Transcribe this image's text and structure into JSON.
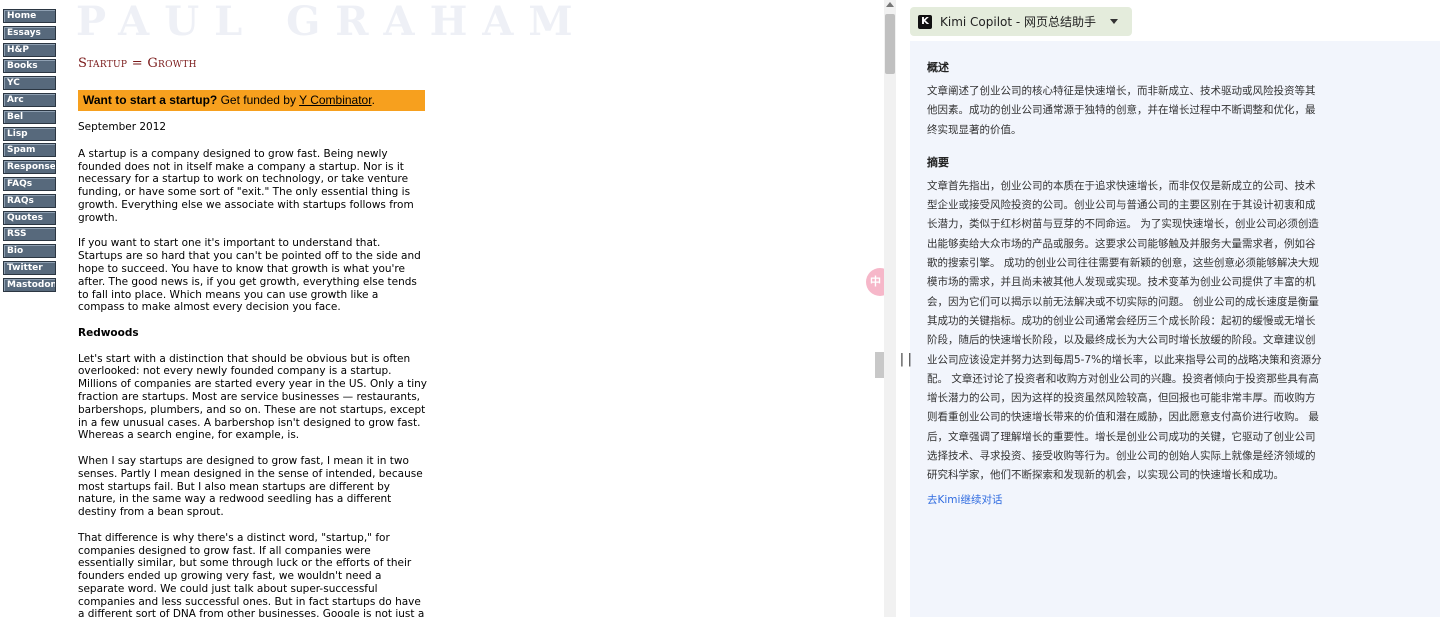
{
  "nav": [
    {
      "label": "Home"
    },
    {
      "label": "Essays"
    },
    {
      "label": "H&P"
    },
    {
      "label": "Books"
    },
    {
      "label": "YC"
    },
    {
      "label": "Arc"
    },
    {
      "label": "Bel"
    },
    {
      "label": "Lisp"
    },
    {
      "label": "Spam"
    },
    {
      "label": "Responses"
    },
    {
      "label": "FAQs"
    },
    {
      "label": "RAQs"
    },
    {
      "label": "Quotes"
    },
    {
      "label": "RSS"
    },
    {
      "label": "Bio"
    },
    {
      "label": "Twitter"
    },
    {
      "label": "Mastodon"
    }
  ],
  "site": {
    "logo": "PAUL GRAHAM"
  },
  "article": {
    "title": "Startup = Growth",
    "banner": {
      "bold": "Want to start a startup?",
      "text": " Get funded by ",
      "link": "Y Combinator",
      "suffix": "."
    },
    "date": "September 2012",
    "paragraphs": [
      "A startup is a company designed to grow fast. Being newly founded does not in itself make a company a startup. Nor is it necessary for a startup to work on technology, or take venture funding, or have some sort of \"exit.\" The only essential thing is growth. Everything else we associate with startups follows from growth.",
      "If you want to start one it's important to understand that. Startups are so hard that you can't be pointed off to the side and hope to succeed. You have to know that growth is what you're after. The good news is, if you get growth, everything else tends to fall into place. Which means you can use growth like a compass to make almost every decision you face."
    ],
    "subhead": "Redwoods",
    "paragraphs2": [
      "Let's start with a distinction that should be obvious but is often overlooked: not every newly founded company is a startup. Millions of companies are started every year in the US. Only a tiny fraction are startups. Most are service businesses — restaurants, barbershops, plumbers, and so on. These are not startups, except in a few unusual cases. A barbershop isn't designed to grow fast. Whereas a search engine, for example, is.",
      "When I say startups are designed to grow fast, I mean it in two senses. Partly I mean designed in the sense of intended, because most startups fail. But I also mean startups are different by nature, in the same way a redwood seedling has a different destiny from a bean sprout.",
      "That difference is why there's a distinct word, \"startup,\" for companies designed to grow fast. If all companies were essentially similar, but some through luck or the efforts of their founders ended up growing very fast, we wouldn't need a separate word. We could just talk about super-successful companies and less successful ones. But in fact startups do have a different sort of DNA from other businesses. Google is not just a"
    ]
  },
  "float_icon": {
    "label": "中"
  },
  "divider": {
    "handle": "||"
  },
  "panel": {
    "logo_letter": "K",
    "title": "Kimi Copilot - 网页总结助手",
    "overview_title": "概述",
    "overview_text": "文章阐述了创业公司的核心特征是快速增长，而非新成立、技术驱动或风险投资等其他因素。成功的创业公司通常源于独特的创意，并在增长过程中不断调整和优化，最终实现显著的价值。",
    "summary_title": "摘要",
    "summary_text": "文章首先指出，创业公司的本质在于追求快速增长，而非仅仅是新成立的公司、技术型企业或接受风险投资的公司。创业公司与普通公司的主要区别在于其设计初衷和成长潜力，类似于红杉树苗与豆芽的不同命运。 为了实现快速增长，创业公司必须创造出能够卖给大众市场的产品或服务。这要求公司能够触及并服务大量需求者，例如谷歌的搜索引擎。 成功的创业公司往往需要有新颖的创意，这些创意必须能够解决大规模市场的需求，并且尚未被其他人发现或实现。技术变革为创业公司提供了丰富的机会，因为它们可以揭示以前无法解决或不切实际的问题。 创业公司的成长速度是衡量其成功的关键指标。成功的创业公司通常会经历三个成长阶段：起初的缓慢或无增长阶段，随后的快速增长阶段，以及最终成长为大公司时增长放缓的阶段。文章建议创业公司应该设定并努力达到每周5-7%的增长率，以此来指导公司的战略决策和资源分配。 文章还讨论了投资者和收购方对创业公司的兴趣。投资者倾向于投资那些具有高增长潜力的公司，因为这样的投资虽然风险较高，但回报也可能非常丰厚。而收购方则看重创业公司的快速增长带来的价值和潜在威胁，因此愿意支付高价进行收购。 最后，文章强调了理解增长的重要性。增长是创业公司成功的关键，它驱动了创业公司选择技术、寻求投资、接受收购等行为。创业公司的创始人实际上就像是经济领域的研究科学家，他们不断探索和发现新的机会，以实现公司的快速增长和成功。",
    "link_text": "去Kimi继续对话"
  }
}
